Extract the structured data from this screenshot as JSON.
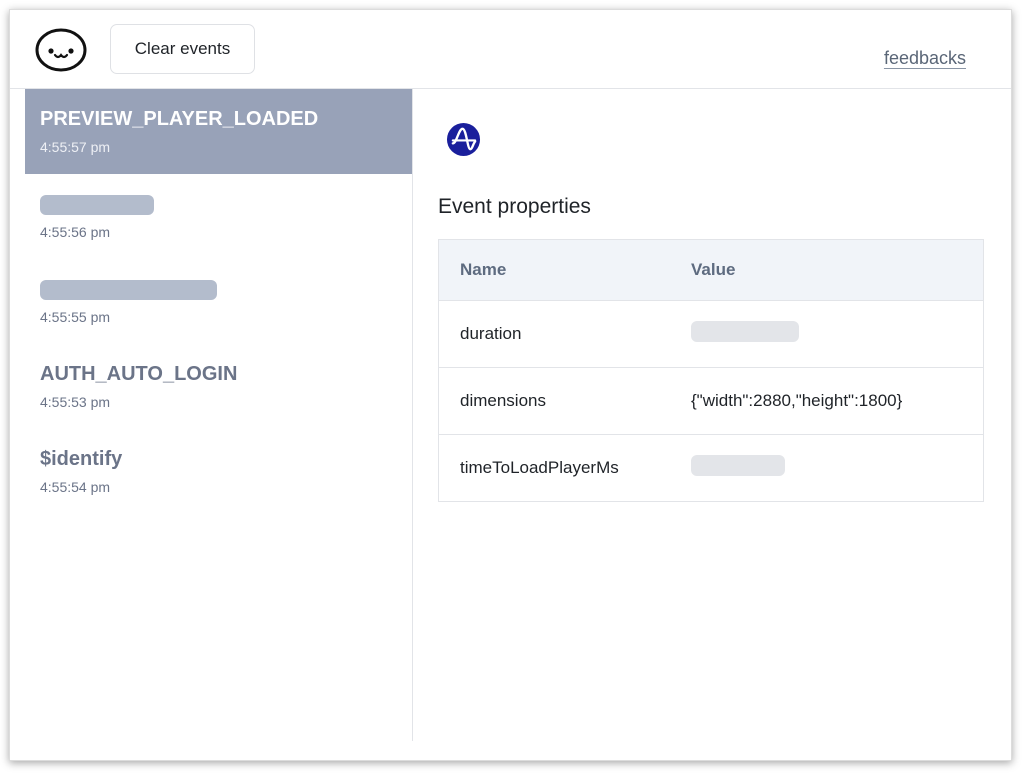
{
  "toolbar": {
    "clear_label": "Clear events",
    "feedback_label": "feedbacks"
  },
  "events": [
    {
      "name": "PREVIEW_PLAYER_LOADED",
      "time": "4:55:57 pm",
      "active": true,
      "redacted": false
    },
    {
      "name": "",
      "time": "4:55:56 pm",
      "active": false,
      "redacted": true
    },
    {
      "name": "",
      "time": "4:55:55 pm",
      "active": false,
      "redacted": true
    },
    {
      "name": "AUTH_AUTO_LOGIN",
      "time": "4:55:53 pm",
      "active": false,
      "redacted": false
    },
    {
      "name": "$identify",
      "time": "4:55:54 pm",
      "active": false,
      "redacted": false
    }
  ],
  "detail": {
    "brand_icon": "amplitude-logo-icon",
    "section_title": "Event properties",
    "columns": {
      "name": "Name",
      "value": "Value"
    },
    "properties": [
      {
        "name": "duration",
        "value": "",
        "redacted": true
      },
      {
        "name": "dimensions",
        "value": "{\"width\":2880,\"height\":1800}",
        "redacted": false
      },
      {
        "name": "timeToLoadPlayerMs",
        "value": "",
        "redacted": true
      }
    ]
  },
  "colors": {
    "active_event_bg": "#98a2b8",
    "brand_blue": "#1a1f9c",
    "table_header_bg": "#f1f4f9"
  }
}
